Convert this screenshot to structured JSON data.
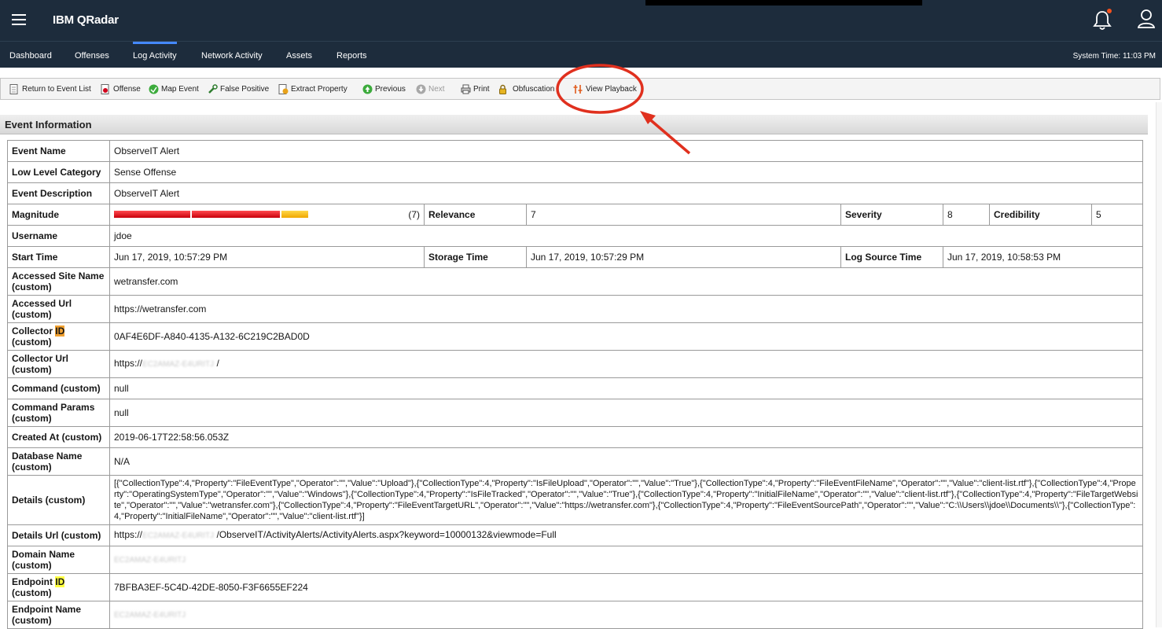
{
  "app": {
    "title": "IBM QRadar"
  },
  "nav": {
    "tabs": [
      "Dashboard",
      "Offenses",
      "Log Activity",
      "Network Activity",
      "Assets",
      "Reports"
    ],
    "active": "Log Activity",
    "system_time": "System Time: 11:03 PM"
  },
  "toolbar": {
    "return_label": "Return to Event List",
    "offense_label": "Offense",
    "map_event_label": "Map Event",
    "false_positive_label": "False Positive",
    "extract_property_label": "Extract Property",
    "previous_label": "Previous",
    "next_label": "Next",
    "print_label": "Print",
    "obfuscation_label": "Obfuscation",
    "view_playback_label": "View Playback"
  },
  "section": {
    "title": "Event Information"
  },
  "event": {
    "event_name_label": "Event Name",
    "event_name": "ObserveIT Alert",
    "low_level_category_label": "Low Level Category",
    "low_level_category": "Sense Offense",
    "event_description_label": "Event Description",
    "event_description": "ObserveIT Alert",
    "magnitude_label": "Magnitude",
    "magnitude": "(7)",
    "magnitude_fraction": 0.7,
    "relevance_label": "Relevance",
    "relevance": "7",
    "severity_label": "Severity",
    "severity": "8",
    "credibility_label": "Credibility",
    "credibility": "5",
    "username_label": "Username",
    "username": "jdoe",
    "start_time_label": "Start Time",
    "start_time": "Jun 17, 2019, 10:57:29 PM",
    "storage_time_label": "Storage Time",
    "storage_time": "Jun 17, 2019, 10:57:29 PM",
    "log_source_time_label": "Log Source Time",
    "log_source_time": "Jun 17, 2019, 10:58:53 PM",
    "accessed_site_name_label": "Accessed Site Name (custom)",
    "accessed_site_name": "wetransfer.com",
    "accessed_url_label": "Accessed Url (custom)",
    "accessed_url": "https://wetransfer.com",
    "collector_id_label_a": "Collector ",
    "collector_id_label_b": "ID",
    "collector_id_label_c": "(custom)",
    "collector_id": "0AF4E6DF-A840-4135-A132-6C219C2BAD0D",
    "collector_url_label": "Collector Url (custom)",
    "collector_url_prefix": "https://",
    "collector_url_suffix": " /",
    "command_label": "Command (custom)",
    "command": "null",
    "command_params_label": "Command Params (custom)",
    "command_params": "null",
    "created_at_label": "Created At (custom)",
    "created_at": "2019-06-17T22:58:56.053Z",
    "database_name_label": "Database Name (custom)",
    "database_name": "N/A",
    "details_label": "Details (custom)",
    "details": "[{\"CollectionType\":4,\"Property\":\"FileEventType\",\"Operator\":\"\",\"Value\":\"Upload\"},{\"CollectionType\":4,\"Property\":\"IsFileUpload\",\"Operator\":\"\",\"Value\":\"True\"},{\"CollectionType\":4,\"Property\":\"FileEventFileName\",\"Operator\":\"\",\"Value\":\"client-list.rtf\"},{\"CollectionType\":4,\"Property\":\"OperatingSystemType\",\"Operator\":\"\",\"Value\":\"Windows\"},{\"CollectionType\":4,\"Property\":\"IsFileTracked\",\"Operator\":\"\",\"Value\":\"True\"},{\"CollectionType\":4,\"Property\":\"InitialFileName\",\"Operator\":\"\",\"Value\":\"client-list.rtf\"},{\"CollectionType\":4,\"Property\":\"FileTargetWebsite\",\"Operator\":\"\",\"Value\":\"wetransfer.com\"},{\"CollectionType\":4,\"Property\":\"FileEventTargetURL\",\"Operator\":\"\",\"Value\":\"https://wetransfer.com\"},{\"CollectionType\":4,\"Property\":\"FileEventSourcePath\",\"Operator\":\"\",\"Value\":\"C:\\\\Users\\\\jdoe\\\\Documents\\\\\"},{\"CollectionType\":4,\"Property\":\"InitialFileName\",\"Operator\":\"\",\"Value\":\"client-list.rtf\"}]",
    "details_url_label": "Details Url (custom)",
    "details_url_prefix": "https://",
    "details_url_suffix": " /ObserveIT/ActivityAlerts/ActivityAlerts.aspx?keyword=10000132&viewmode=Full",
    "domain_name_label": "Domain Name (custom)",
    "endpoint_id_label_a": "Endpoint ",
    "endpoint_id_label_b": "ID",
    "endpoint_id_label_c": "(custom)",
    "endpoint_id": "7BFBA3EF-5C4D-42DE-8050-F3F6655EF224",
    "endpoint_name_label": "Endpoint Name (custom)"
  },
  "colors": {
    "topbar": "#1d2c3c",
    "accent": "#4589ff",
    "annotation": "#e0301e",
    "bar_red": "#e8111c",
    "bar_yellow": "#f6c21a"
  }
}
